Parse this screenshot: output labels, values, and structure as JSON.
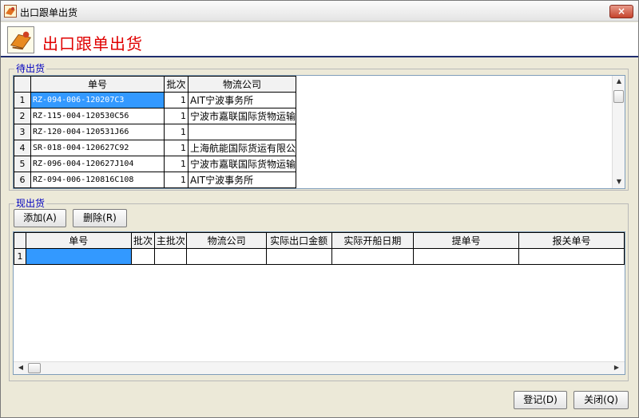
{
  "window": {
    "title": "出口跟单出货",
    "close_label": "×",
    "header_title": "出口跟单出货"
  },
  "pending": {
    "group_label": "待出货",
    "columns": [
      "单号",
      "批次",
      "物流公司"
    ],
    "rows": [
      {
        "index": "1",
        "order_no": "RZ-094-006-120207C3",
        "batch": "1",
        "logistics": "AIT宁波事务所"
      },
      {
        "index": "2",
        "order_no": "RZ-115-004-120530C56",
        "batch": "1",
        "logistics": "宁波市嘉联国际货物运输"
      },
      {
        "index": "3",
        "order_no": "RZ-120-004-120531J66",
        "batch": "1",
        "logistics": ""
      },
      {
        "index": "4",
        "order_no": "SR-018-004-120627C92",
        "batch": "1",
        "logistics": "上海航能国际货运有限公"
      },
      {
        "index": "5",
        "order_no": "RZ-096-004-120627J104",
        "batch": "1",
        "logistics": "宁波市嘉联国际货物运输"
      },
      {
        "index": "6",
        "order_no": "RZ-094-006-120816C108",
        "batch": "1",
        "logistics": "AIT宁波事务所"
      }
    ]
  },
  "current": {
    "group_label": "现出货",
    "add_label": "添加(A)",
    "delete_label": "删除(R)",
    "columns": [
      "单号",
      "批次",
      "主批次",
      "物流公司",
      "实际出口金额",
      "实际开船日期",
      "提单号",
      "报关单号"
    ],
    "rows": [
      {
        "index": "1"
      }
    ]
  },
  "footer": {
    "register_label": "登记(D)",
    "close_label": "关闭(Q)"
  },
  "colors": {
    "header_title": "#e00000",
    "group_label": "#0000c0",
    "selection": "#3399ff",
    "header_rule": "#1f2d6e"
  }
}
